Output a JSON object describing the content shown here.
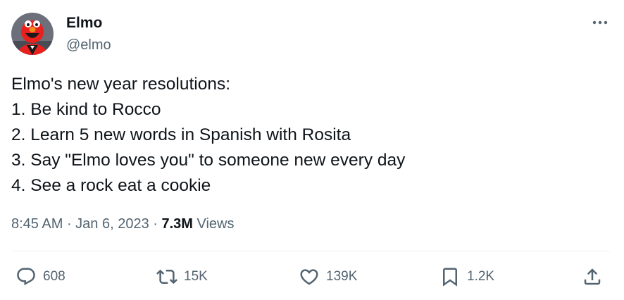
{
  "author": {
    "name": "Elmo",
    "handle": "@elmo",
    "avatar_icon": "elmo-avatar"
  },
  "tweet": {
    "lines": [
      "Elmo's new year resolutions:",
      "1. Be kind to Rocco",
      "2. Learn 5 new words in Spanish with Rosita",
      "3. Say \"Elmo loves you\" to someone new every day",
      "4. See a rock eat a cookie"
    ]
  },
  "meta": {
    "time": "8:45 AM",
    "sep1": " · ",
    "date": "Jan 6, 2023",
    "sep2": " · ",
    "views_count": "7.3M",
    "views_label": " Views"
  },
  "actions": {
    "replies": "608",
    "retweets": "15K",
    "likes": "139K",
    "bookmarks": "1.2K"
  },
  "colors": {
    "text": "#0f1419",
    "secondary": "#536471",
    "divider": "#eff3f4",
    "avatar_bg": "#6d6f7a",
    "elmo_red": "#e8211f"
  }
}
